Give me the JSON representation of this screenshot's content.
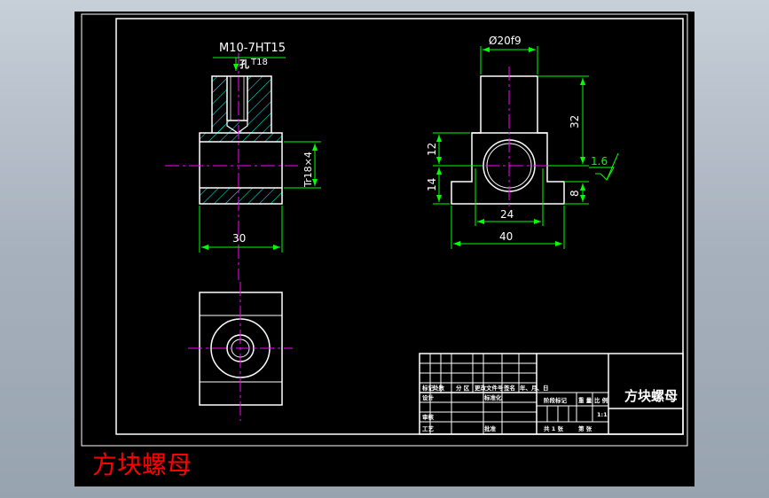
{
  "colors": {
    "background": "#000000",
    "outline": "#ffffff",
    "dimension": "#00ff00",
    "centerline": "#ff00ff",
    "hatch": "#00ffff",
    "caption": "#ff0000"
  },
  "drawing": {
    "thread_note": "M10-7HT15",
    "hole_note_char": "孔",
    "hole_note_depth": "T18",
    "thread_dim": "Tr18×4",
    "dim_width_front": "30",
    "dim_diameter": "Ø20f9",
    "dim_height_boss": "32",
    "dim_upper": "12",
    "dim_lower": "14",
    "dim_flange": "8",
    "dim_bore": "24",
    "dim_base": "40",
    "roughness": "1.6"
  },
  "title_block": {
    "part_name": "方块螺母",
    "labels": {
      "mark": "标记",
      "count": "处数",
      "zone": "分 区",
      "change_doc": "更改文件号",
      "sign": "签名",
      "date": "年、月、日",
      "design": "设计",
      "standardize": "标准化",
      "stage_mark": "阶段标记",
      "weight": "重 量",
      "scale": "比 例",
      "scale_value": "1:1",
      "review": "审核",
      "process": "工艺",
      "approve": "批准",
      "sheets": "共 1 张",
      "sheet": "第 张"
    }
  },
  "caption": "方块螺母"
}
